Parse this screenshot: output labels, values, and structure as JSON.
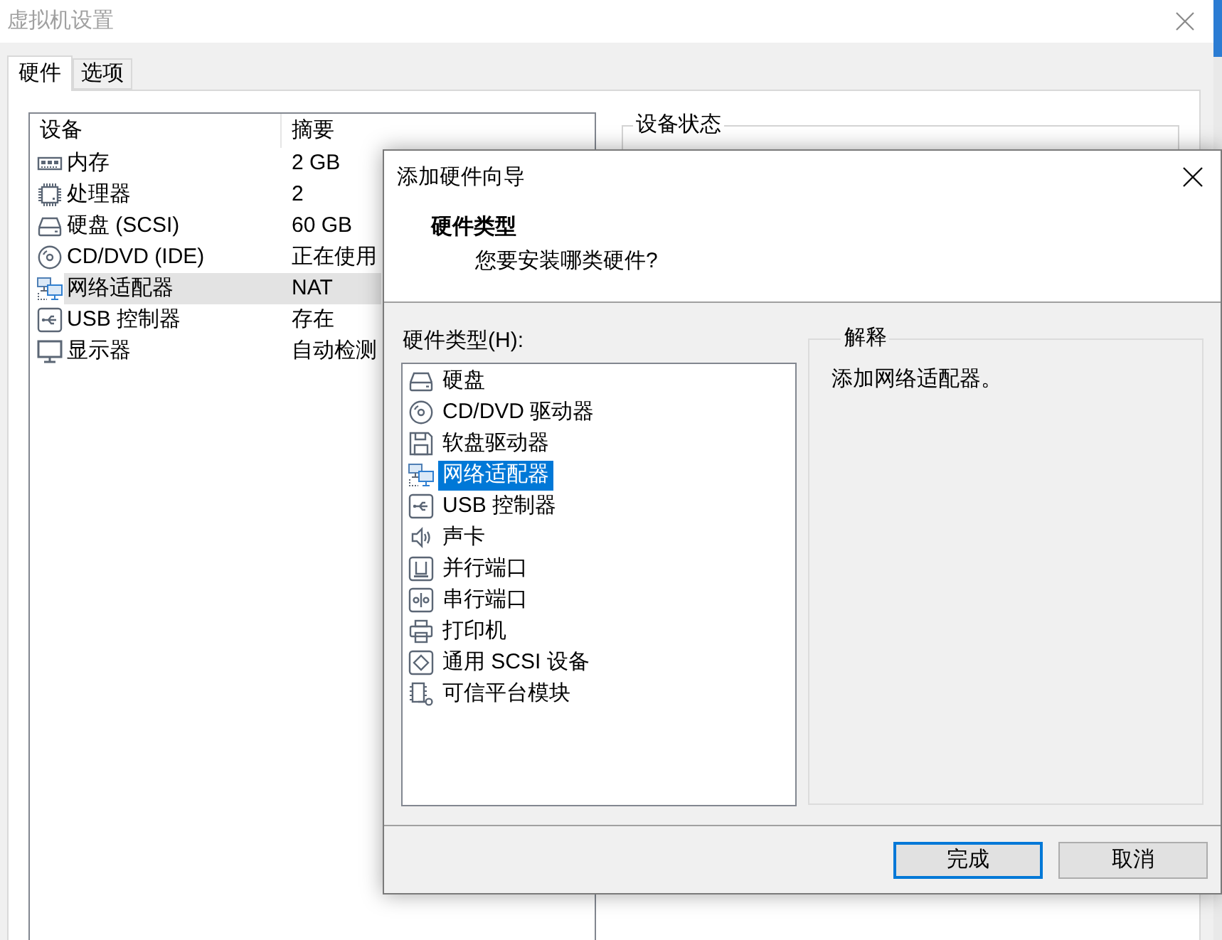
{
  "window": {
    "title": "虚拟机设置"
  },
  "tabs": [
    {
      "label": "硬件",
      "selected": true
    },
    {
      "label": "选项",
      "selected": false
    }
  ],
  "device_table": {
    "columns": [
      "设备",
      "摘要"
    ],
    "rows": [
      {
        "kind": "memory",
        "device": "内存",
        "summary": "2 GB",
        "selected": false
      },
      {
        "kind": "processor",
        "device": "处理器",
        "summary": "2",
        "selected": false
      },
      {
        "kind": "disk",
        "device": "硬盘 (SCSI)",
        "summary": "60 GB",
        "selected": false
      },
      {
        "kind": "cdrom",
        "device": "CD/DVD (IDE)",
        "summary": "正在使用",
        "selected": false
      },
      {
        "kind": "network",
        "device": "网络适配器",
        "summary": "NAT",
        "selected": true
      },
      {
        "kind": "usb",
        "device": "USB 控制器",
        "summary": "存在",
        "selected": false
      },
      {
        "kind": "display",
        "device": "显示器",
        "summary": "自动检测",
        "selected": false
      }
    ]
  },
  "device_status": {
    "legend": "设备状态"
  },
  "dialog": {
    "title": "添加硬件向导",
    "heading": "硬件类型",
    "subheading": "您要安装哪类硬件?",
    "list_label": "硬件类型(H):",
    "hardware_types": [
      {
        "kind": "disk",
        "label": "硬盘",
        "selected": false
      },
      {
        "kind": "cdrom",
        "label": "CD/DVD 驱动器",
        "selected": false
      },
      {
        "kind": "floppy",
        "label": "软盘驱动器",
        "selected": false
      },
      {
        "kind": "network",
        "label": "网络适配器",
        "selected": true
      },
      {
        "kind": "usb",
        "label": "USB 控制器",
        "selected": false
      },
      {
        "kind": "sound",
        "label": "声卡",
        "selected": false
      },
      {
        "kind": "parallel",
        "label": "并行端口",
        "selected": false
      },
      {
        "kind": "serial",
        "label": "串行端口",
        "selected": false
      },
      {
        "kind": "printer",
        "label": "打印机",
        "selected": false
      },
      {
        "kind": "scsi",
        "label": "通用 SCSI 设备",
        "selected": false
      },
      {
        "kind": "tpm",
        "label": "可信平台模块",
        "selected": false
      }
    ],
    "explanation": {
      "legend": "解释",
      "text": "添加网络适配器。"
    },
    "buttons": [
      {
        "label": "完成",
        "default": true
      },
      {
        "label": "取消",
        "default": false
      }
    ]
  }
}
